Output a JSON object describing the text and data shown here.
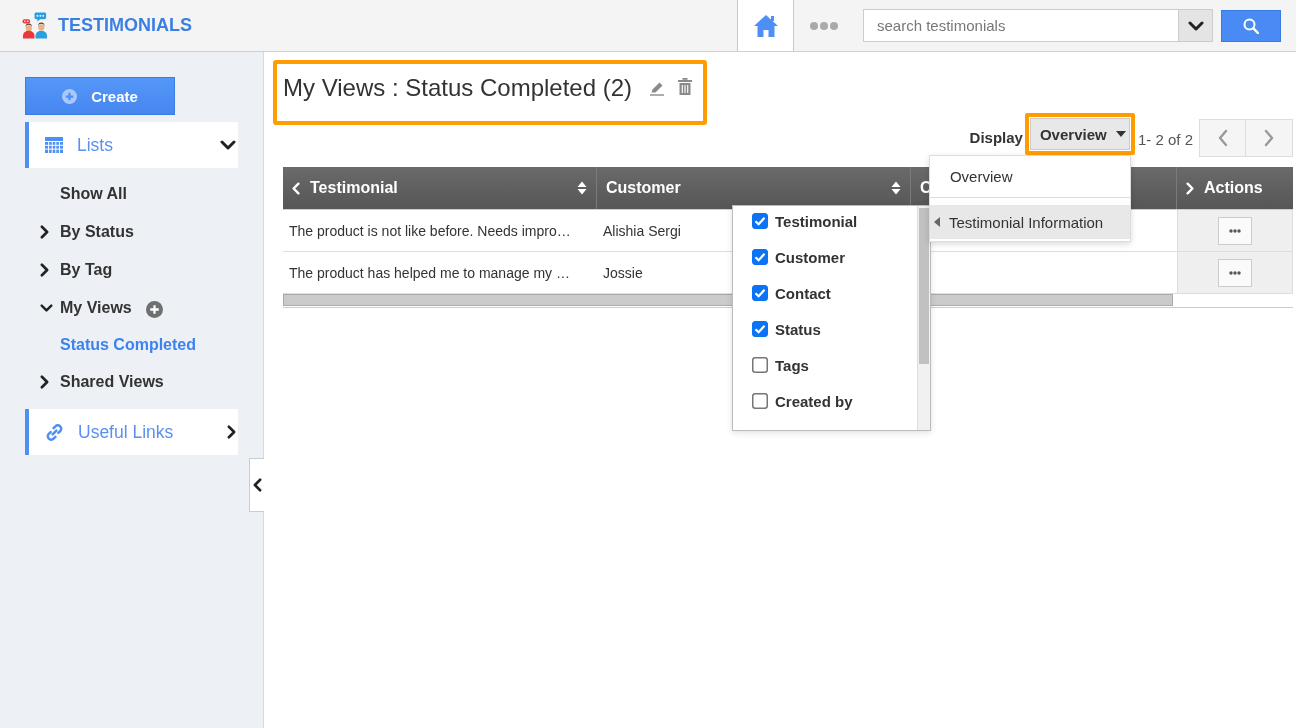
{
  "header": {
    "app_title": "TESTIMONIALS",
    "search": {
      "placeholder": "search testimonials"
    }
  },
  "sidebar": {
    "create_button": "Create",
    "sections": [
      {
        "kind": "tree",
        "label": "Lists",
        "expanded": true,
        "items": [
          {
            "kind": "link",
            "label": "Show All",
            "selected": false,
            "add_button": false
          },
          {
            "kind": "group",
            "label": "By Status",
            "expanded": false,
            "selected": false,
            "add_button": false
          },
          {
            "kind": "group",
            "label": "By Tag",
            "expanded": false,
            "selected": false,
            "add_button": false
          },
          {
            "kind": "group",
            "label": "My Views",
            "expanded": true,
            "selected": false,
            "add_button": true,
            "children": [
              {
                "kind": "link",
                "label": "Status Completed",
                "selected": true,
                "add_button": false
              }
            ]
          },
          {
            "kind": "group",
            "label": "Shared Views",
            "expanded": false,
            "selected": false,
            "add_button": false
          }
        ]
      },
      {
        "kind": "links",
        "label": "Useful Links",
        "expanded": false
      }
    ]
  },
  "view": {
    "title": "My Views : Status Completed (2)",
    "highlighted": true
  },
  "toolbar": {
    "display_label": "Display",
    "display_value": "Overview",
    "display_highlighted": true,
    "range": "1- 2 of 2"
  },
  "display_menu": {
    "items": [
      {
        "kind": "item",
        "label": "Overview",
        "highlighted": false
      },
      {
        "kind": "submenu",
        "label": "Testimonial Information",
        "highlighted": true
      }
    ]
  },
  "table": {
    "columns": [
      {
        "kind": "lead",
        "label": "Testimonial",
        "sortable": true
      },
      {
        "kind": "data",
        "label": "Customer",
        "sortable": true
      },
      {
        "kind": "data",
        "label": "C",
        "sortable": false
      },
      {
        "kind": "actions",
        "label": "Actions",
        "sortable": false
      }
    ],
    "rows": [
      {
        "cells": [
          "The product is not like before. Needs impro…",
          "Alishia Sergi"
        ]
      },
      {
        "cells": [
          "The product has helped me to manage my …",
          "Jossie"
        ]
      }
    ]
  },
  "column_chooser": {
    "items": [
      {
        "label": "Testimonial",
        "checked": true
      },
      {
        "label": "Customer",
        "checked": true
      },
      {
        "label": "Contact",
        "checked": true
      },
      {
        "label": "Status",
        "checked": true
      },
      {
        "label": "Tags",
        "checked": false
      },
      {
        "label": "Created by",
        "checked": false
      }
    ]
  }
}
